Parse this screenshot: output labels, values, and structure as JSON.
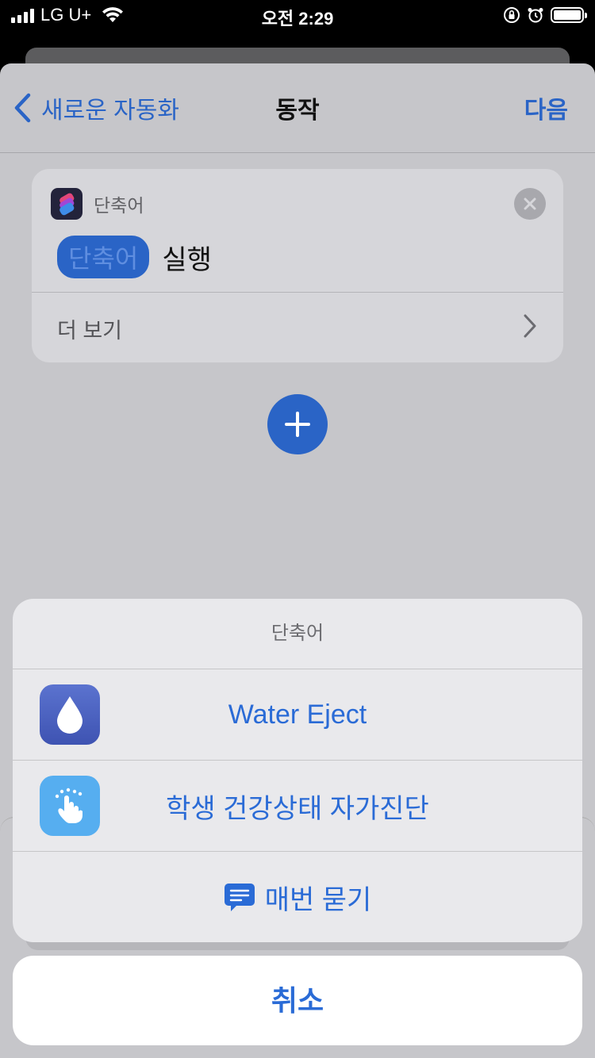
{
  "status_bar": {
    "carrier": "LG U+",
    "time": "오전 2:29"
  },
  "nav": {
    "back_label": "새로운 자동화",
    "title": "동작",
    "next_label": "다음"
  },
  "action_card": {
    "app_name": "단축어",
    "param_pill": "단축어",
    "verb": "실행",
    "more_label": "더 보기"
  },
  "sheet": {
    "title": "단축어",
    "options": [
      {
        "label": "Water Eject",
        "icon": "water-drop-icon"
      },
      {
        "label": "학생 건강상태 자가진단",
        "icon": "hand-tap-icon"
      },
      {
        "label": "매번 묻기",
        "icon": "speech-bubble-icon"
      }
    ],
    "cancel_label": "취소"
  },
  "colors": {
    "accent": "#2a64c6",
    "sheet_bg": "#e9e9ec"
  }
}
